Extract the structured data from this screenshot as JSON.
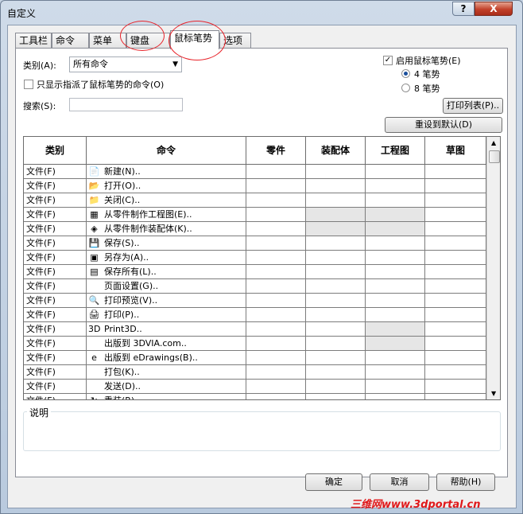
{
  "window": {
    "title": "自定义",
    "help_label": "?",
    "close_label": "X"
  },
  "tabs": [
    {
      "label": "工具栏",
      "active": false
    },
    {
      "label": "命令",
      "active": false
    },
    {
      "label": "菜单",
      "active": false
    },
    {
      "label": "键盘",
      "active": false
    },
    {
      "label": "鼠标笔势",
      "active": true
    },
    {
      "label": "选项",
      "active": false
    }
  ],
  "filters": {
    "category_label": "类别(A):",
    "category_value": "所有命令",
    "only_assigned_label": "只显示指派了鼠标笔势的命令(O)",
    "only_assigned_checked": false,
    "search_label": "搜索(S):",
    "search_value": ""
  },
  "gestures": {
    "enable_label": "启用鼠标笔势(E)",
    "enable_checked": true,
    "four_label": "4 笔势",
    "eight_label": "8 笔势",
    "selected": "4 笔势"
  },
  "buttons": {
    "print_list": "打印列表(P)..",
    "reset_default": "重设到默认(D)",
    "ok": "确定",
    "cancel": "取消",
    "help": "帮助(H)"
  },
  "table": {
    "columns": [
      "类别",
      "命令",
      "零件",
      "装配体",
      "工程图",
      "草图"
    ],
    "rows": [
      {
        "category": "文件(F)",
        "command": "新建(N)..",
        "icon": "new-document-icon",
        "grey": []
      },
      {
        "category": "文件(F)",
        "command": "打开(O)..",
        "icon": "open-folder-icon",
        "grey": []
      },
      {
        "category": "文件(F)",
        "command": "关闭(C)..",
        "icon": "close-folder-icon",
        "grey": []
      },
      {
        "category": "文件(F)",
        "command": "从零件制作工程图(E)..",
        "icon": "make-drawing-icon",
        "grey": [
          3,
          4
        ]
      },
      {
        "category": "文件(F)",
        "command": "从零件制作装配体(K)..",
        "icon": "make-assembly-icon",
        "grey": [
          3,
          4
        ]
      },
      {
        "category": "文件(F)",
        "command": "保存(S)..",
        "icon": "save-icon",
        "grey": []
      },
      {
        "category": "文件(F)",
        "command": "另存为(A)..",
        "icon": "save-as-icon",
        "grey": []
      },
      {
        "category": "文件(F)",
        "command": "保存所有(L)..",
        "icon": "save-all-icon",
        "grey": []
      },
      {
        "category": "文件(F)",
        "command": "页面设置(G)..",
        "icon": "",
        "grey": []
      },
      {
        "category": "文件(F)",
        "command": "打印预览(V)..",
        "icon": "print-preview-icon",
        "grey": []
      },
      {
        "category": "文件(F)",
        "command": "打印(P)..",
        "icon": "print-icon",
        "grey": []
      },
      {
        "category": "文件(F)",
        "command": "Print3D..",
        "icon": "print3d-icon",
        "grey": [
          4
        ]
      },
      {
        "category": "文件(F)",
        "command": "出版到 3DVIA.com..",
        "icon": "",
        "grey": [
          4
        ]
      },
      {
        "category": "文件(F)",
        "command": "出版到 eDrawings(B)..",
        "icon": "edrawings-icon",
        "grey": []
      },
      {
        "category": "文件(F)",
        "command": "打包(K)..",
        "icon": "",
        "grey": []
      },
      {
        "category": "文件(F)",
        "command": "发送(D)..",
        "icon": "",
        "grey": []
      },
      {
        "category": "文件(F)",
        "command": "重装(R)..",
        "icon": "reload-icon",
        "grey": []
      }
    ]
  },
  "description": {
    "label": "说明"
  },
  "watermark": "三维网www.3dportal.cn"
}
